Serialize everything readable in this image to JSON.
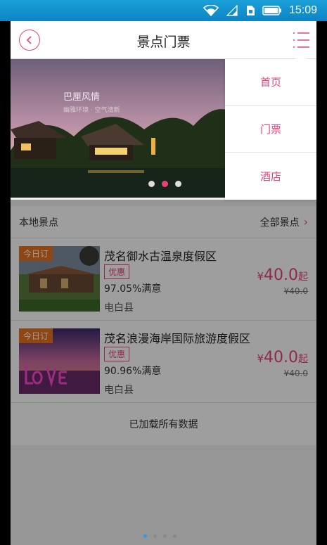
{
  "status_bar": {
    "time": "15:09"
  },
  "header": {
    "title": "景点门票"
  },
  "banner": {
    "title": "巴厘风情",
    "subtitle": "幽雅环境 · 空气清新"
  },
  "menu": {
    "items": [
      {
        "label": "首页"
      },
      {
        "label": "门票"
      },
      {
        "label": "酒店"
      }
    ]
  },
  "section": {
    "title": "本地景点",
    "all_link": "全部景点"
  },
  "listings": [
    {
      "tag": "今日订",
      "name": "茂名御水古温泉度假区",
      "badge": "优惠",
      "satisfaction": "97.05%满意",
      "region": "电白县",
      "currency": "¥",
      "price": "40.0",
      "unit": "起",
      "original_price": "¥40.0"
    },
    {
      "tag": "今日订",
      "name": "茂名浪漫海岸国际旅游度假区",
      "badge": "优惠",
      "satisfaction": "90.96%满意",
      "region": "电白县",
      "currency": "¥",
      "price": "40.0",
      "unit": "起",
      "original_price": "¥40.0"
    }
  ],
  "footer": {
    "loaded_text": "已加载所有数据"
  },
  "colors": {
    "accent": "#e8427a",
    "tag": "#e8721f",
    "status_bar": "#1aa0d8"
  },
  "icons": [
    "wifi-icon",
    "signal-icon",
    "sim-icon",
    "battery-icon",
    "back-arrow-icon",
    "menu-list-icon",
    "chevron-right-icon"
  ]
}
